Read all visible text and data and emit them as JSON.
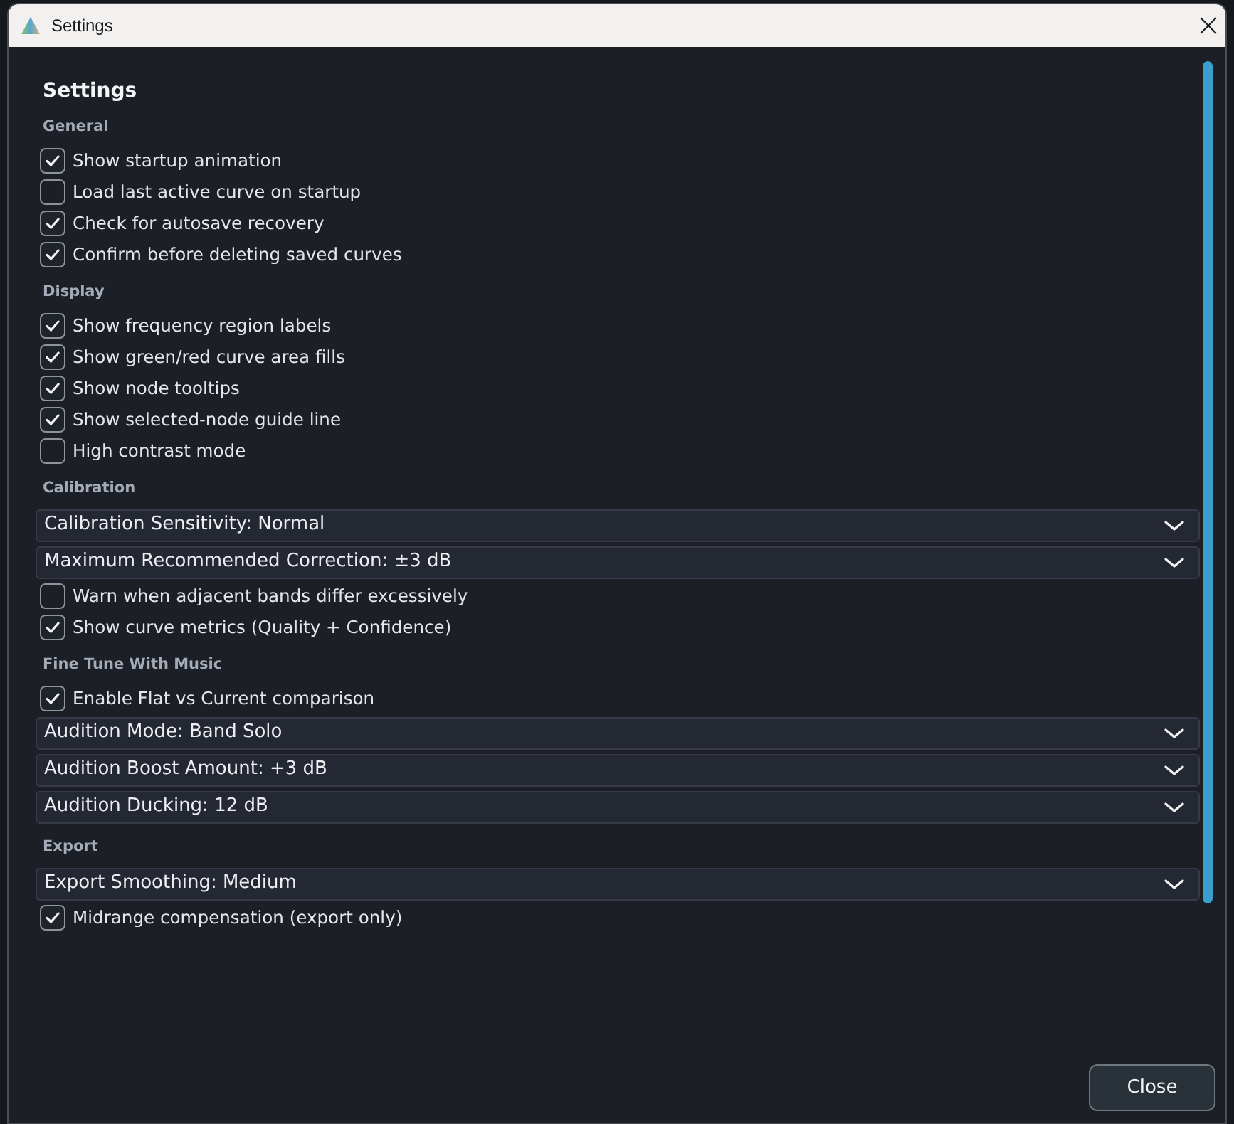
{
  "window": {
    "title": "Settings"
  },
  "heading": "Settings",
  "sections": [
    {
      "title": "General",
      "items": [
        {
          "kind": "checkbox",
          "label": "Show startup animation",
          "checked": true
        },
        {
          "kind": "checkbox",
          "label": "Load last active curve on startup",
          "checked": false
        },
        {
          "kind": "checkbox",
          "label": "Check for autosave recovery",
          "checked": true
        },
        {
          "kind": "checkbox",
          "label": "Confirm before deleting saved curves",
          "checked": true
        }
      ]
    },
    {
      "title": "Display",
      "items": [
        {
          "kind": "checkbox",
          "label": "Show frequency region labels",
          "checked": true
        },
        {
          "kind": "checkbox",
          "label": "Show green/red curve area fills",
          "checked": true
        },
        {
          "kind": "checkbox",
          "label": "Show node tooltips",
          "checked": true
        },
        {
          "kind": "checkbox",
          "label": "Show selected-node guide line",
          "checked": true
        },
        {
          "kind": "checkbox",
          "label": "High contrast mode",
          "checked": false
        }
      ]
    },
    {
      "title": "Calibration",
      "items": [
        {
          "kind": "dropdown",
          "value": "Calibration Sensitivity: Normal"
        },
        {
          "kind": "dropdown",
          "value": "Maximum Recommended Correction: ±3 dB"
        },
        {
          "kind": "checkbox",
          "label": "Warn when adjacent bands differ excessively",
          "checked": false
        },
        {
          "kind": "checkbox",
          "label": "Show curve metrics (Quality + Confidence)",
          "checked": true
        }
      ]
    },
    {
      "title": "Fine Tune With Music",
      "items": [
        {
          "kind": "checkbox",
          "label": "Enable Flat vs Current comparison",
          "checked": true
        },
        {
          "kind": "dropdown",
          "value": "Audition Mode: Band Solo"
        },
        {
          "kind": "dropdown",
          "value": "Audition Boost Amount: +3 dB"
        },
        {
          "kind": "dropdown",
          "value": "Audition Ducking: 12 dB"
        }
      ]
    },
    {
      "title": "Export",
      "items": [
        {
          "kind": "dropdown",
          "value": "Export Smoothing: Medium"
        },
        {
          "kind": "checkbox",
          "label": "Midrange compensation (export only)",
          "checked": true
        }
      ]
    }
  ],
  "buttons": [
    "Close"
  ]
}
